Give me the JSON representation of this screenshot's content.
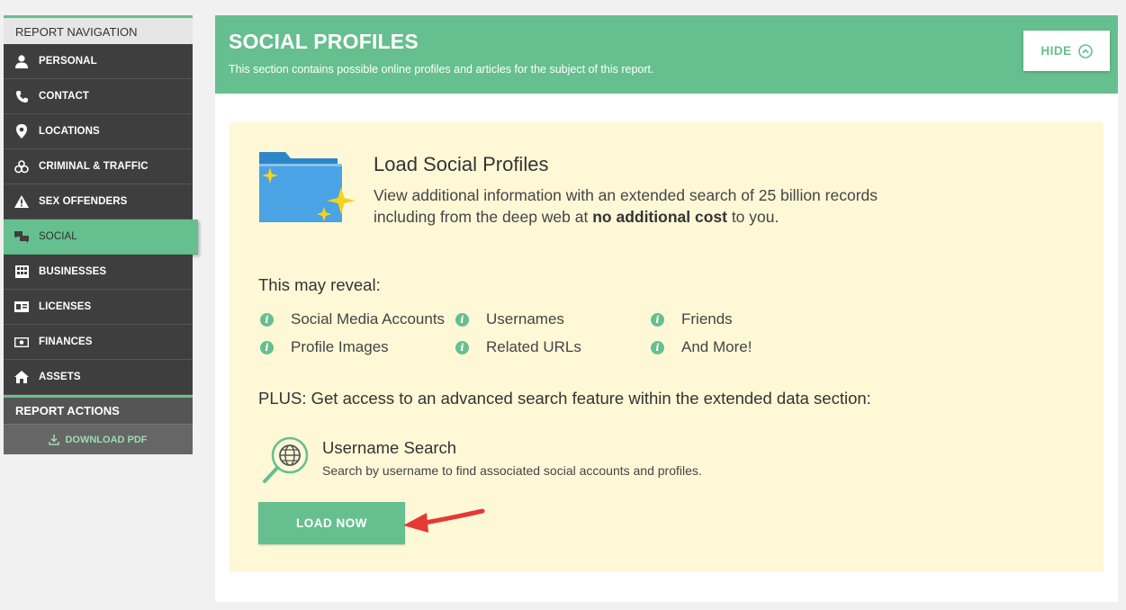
{
  "sidebar": {
    "header": "REPORT NAVIGATION",
    "items": [
      {
        "label": "PERSONAL",
        "icon": "person-icon"
      },
      {
        "label": "CONTACT",
        "icon": "phone-icon"
      },
      {
        "label": "LOCATIONS",
        "icon": "location-pin-icon"
      },
      {
        "label": "CRIMINAL & TRAFFIC",
        "icon": "handcuffs-icon"
      },
      {
        "label": "SEX OFFENDERS",
        "icon": "warning-icon"
      },
      {
        "label": "SOCIAL",
        "icon": "chat-bubbles-icon"
      },
      {
        "label": "BUSINESSES",
        "icon": "building-icon"
      },
      {
        "label": "LICENSES",
        "icon": "id-card-icon"
      },
      {
        "label": "FINANCES",
        "icon": "money-icon"
      },
      {
        "label": "ASSETS",
        "icon": "home-icon"
      }
    ],
    "active": "SOCIAL",
    "actions_header": "REPORT ACTIONS",
    "download_label": "DOWNLOAD PDF"
  },
  "banner": {
    "title": "SOCIAL PROFILES",
    "subtitle": "This section contains possible online profiles and articles for the subject of this report.",
    "hide_label": "HIDE"
  },
  "panel": {
    "title": "Load Social Profiles",
    "desc_1": "View additional information with an extended search of 25 billion records including from the deep web at ",
    "desc_bold": "no additional cost",
    "desc_2": " to you.",
    "reveal_title": "This may reveal:",
    "reveal_items": [
      "Social Media Accounts",
      "Usernames",
      "Friends",
      "Profile Images",
      "Related URLs",
      "And More!"
    ],
    "plus": "PLUS: Get access to an advanced search feature within the extended data section:",
    "username_title": "Username Search",
    "username_desc": "Search by username to find associated social accounts and profiles.",
    "load_label": "LOAD NOW"
  },
  "colors": {
    "accent": "#66bf8f",
    "sidebar_bg": "#3e3e3e",
    "panel_bg": "#fff8d7",
    "arrow": "#e53935"
  }
}
